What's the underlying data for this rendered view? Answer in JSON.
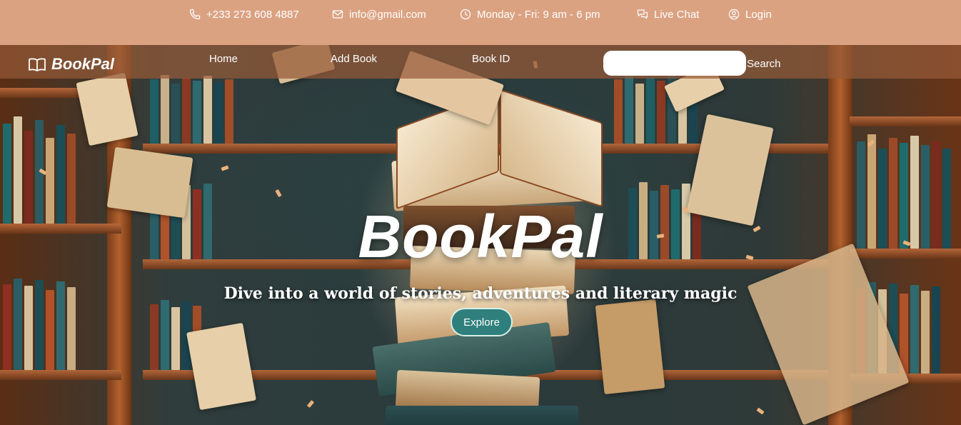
{
  "topbar": {
    "phone": "+233 273 608 4887",
    "email": "info@gmail.com",
    "hours": "Monday - Fri: 9 am - 6 pm",
    "live_chat": "Live Chat",
    "login": "Login"
  },
  "nav": {
    "brand": "BookPal",
    "links": [
      "Home",
      "Add Book",
      "Book ID"
    ],
    "search_placeholder": "",
    "search_label": "Search"
  },
  "hero": {
    "title": "BookPal",
    "subtitle": "Dive into a world of stories, adventures and literary magic",
    "cta": "Explore"
  },
  "colors": {
    "topbar_bg": "#dba282",
    "nav_bg": "#965a37",
    "cta_bg": "#2f7f7c"
  },
  "icons": [
    "phone-icon",
    "mail-icon",
    "clock-icon",
    "chat-icon",
    "user-icon",
    "book-icon"
  ]
}
